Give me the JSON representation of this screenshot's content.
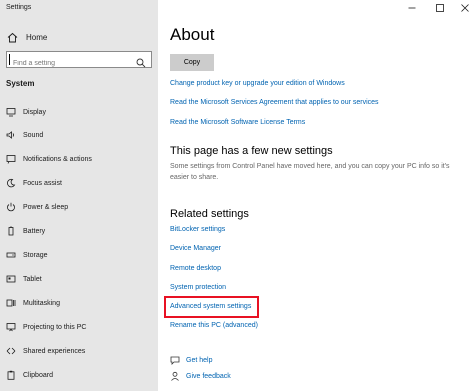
{
  "window": {
    "title": "Settings"
  },
  "sidebar": {
    "home_label": "Home",
    "search_placeholder": "Find a setting",
    "section_label": "System",
    "items": [
      {
        "label": "Display",
        "icon": "display-icon"
      },
      {
        "label": "Sound",
        "icon": "sound-icon"
      },
      {
        "label": "Notifications & actions",
        "icon": "notifications-icon"
      },
      {
        "label": "Focus assist",
        "icon": "focus-assist-icon"
      },
      {
        "label": "Power & sleep",
        "icon": "power-icon"
      },
      {
        "label": "Battery",
        "icon": "battery-icon"
      },
      {
        "label": "Storage",
        "icon": "storage-icon"
      },
      {
        "label": "Tablet",
        "icon": "tablet-icon"
      },
      {
        "label": "Multitasking",
        "icon": "multitasking-icon"
      },
      {
        "label": "Projecting to this PC",
        "icon": "projecting-icon"
      },
      {
        "label": "Shared experiences",
        "icon": "shared-experiences-icon"
      },
      {
        "label": "Clipboard",
        "icon": "clipboard-icon"
      }
    ]
  },
  "main": {
    "title": "About",
    "copy_button": "Copy",
    "links_top": [
      "Change product key or upgrade your edition of Windows",
      "Read the Microsoft Services Agreement that applies to our services",
      "Read the Microsoft Software License Terms"
    ],
    "new_settings_heading": "This page has a few new settings",
    "new_settings_text": "Some settings from Control Panel have moved here, and you can copy your PC info so it's easier to share.",
    "related_heading": "Related settings",
    "related_links": [
      "BitLocker settings",
      "Device Manager",
      "Remote desktop",
      "System protection",
      "Advanced system settings",
      "Rename this PC (advanced)"
    ],
    "get_help": "Get help",
    "give_feedback": "Give feedback"
  },
  "colors": {
    "link": "#0063b1",
    "highlight": "#e81123",
    "sidebar_bg": "#e6e6e6"
  }
}
